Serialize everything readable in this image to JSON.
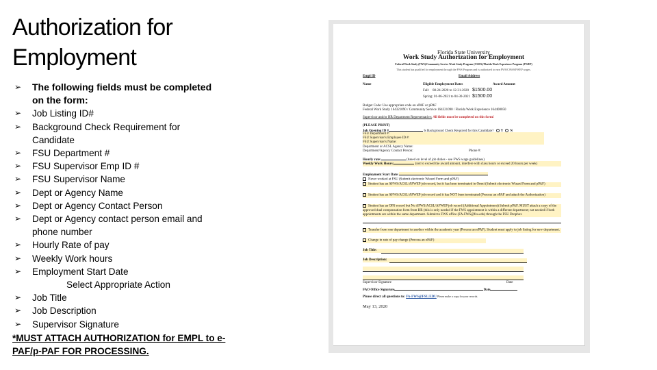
{
  "slide": {
    "title_line1": "Authorization for",
    "title_line2": "Employment",
    "lead_bullet_line1": "The following fields must be completed",
    "lead_bullet_line2": "on the form:",
    "bullet_glyph": "➢",
    "bullets_group1": [
      "Job Listing ID#",
      "Background Check Requirement for",
      "Candidate",
      "FSU Department #",
      "FSU Supervisor Emp ID #",
      "FSU Supervisor Name",
      "Dept or Agency Name",
      "Dept or Agency Contact Person",
      "Dept or Agency contact person email and",
      "phone number",
      "Hourly Rate of pay",
      "Weekly Work hours",
      "Employment Start Date"
    ],
    "centered_note": "Select Appropriate Action",
    "bullets_group2": [
      "Job Title",
      "Job Description",
      "Supervisor Signature"
    ],
    "must_attach_line1": "*MUST ATTACH AUTHORIZATION for EMPL to e-",
    "must_attach_line2": "PAF/p-PAF FOR PROCESSING."
  },
  "form_image": {
    "university": "Florida State University",
    "form_title": "Work Study Authorization for Employment",
    "programs": "Federal Work Study (FWS)/Community Service Work Study Program (CSWS)/Florida Work Experience Program (FWEP)",
    "eligibility_note": "This student has qualified for employment through the FWS Program and is authorized to earn FWS/CSWS/FWEP wages.",
    "emplid_label": "Empl ID",
    "email_label": "Email Address",
    "name_label": "Name",
    "dates_label": "Eligible Employment Dates",
    "award_label": "Award Amount",
    "term1": "Fall:",
    "term1_dates": "08-24-2020 to 12-31-2020",
    "term1_amount": "$1500.00",
    "term2": "Spring:",
    "term2_dates": "01-06-2021 to 04-30-2021",
    "term2_amount": "$1500.00",
    "budget_line1": "Budget Code: Use appropriate code on ePAF or pPAF",
    "budget_line2": "Federal Work Study 164321090 / Community Service 164321090 / Florida Work Experience 164400050",
    "supervisor_heading": "Supervisor and/or HR Department Representative:",
    "required_note": "All fields must be completed on this form!",
    "please_print": "(PLEASE PRINT)",
    "job_opening_label": "Job Opening ID #",
    "bg_check_label": "Is Background Check Required for this Candidate?",
    "yes_label": "Y",
    "no_label": "N",
    "dept_label": "FSU Department #:",
    "sup_emplid_label": "FSU Supervisor's Employee ID #:",
    "sup_name_label": "FSU Supervisor's Name:",
    "agency_label": "Department or ACSL Agency Name:",
    "contact_label": "Department/Agency Contact Person:",
    "phone_label": "Phone #:",
    "hourly_label": "Hourly rate:",
    "hourly_note": "(based on level of job duties - see FWS wage guidelines)",
    "weekly_label": "Weekly Work Hours:",
    "weekly_note": "(not to exceed the award amount, interfere with class hours or exceed 20 hours per week)",
    "start_label": "Employment Start Date:",
    "options": [
      "Never worked at FSU (Submit electronic Wizard Form and pPAF)",
      "Student has an AFWS/ACSL/AFWEP job record, but it has been terminated in Omni (Submit electronic Wizard Form and pPAF)",
      "Student has an AFWS/ACSL/AFWEP job record and it has NOT been terminated (Process an ePAF and attach the Authorization)",
      "Student has an OPS record but No AFWS/ACSL/AFWEP job record (Additional Appointment) Submit pPAF. MUST attach a copy of the approved dual compensation form from HR (this is only needed if the FWS appointment is within a different department; not needed if both appointments are within the same department. Submit to FWS office (FA-FWS@fsu.edu) through the FSU Dropbox",
      "Transfer from one department to another within the academic year (Process an ePAF). Student must apply to job listing for new department.",
      "Change in rate of pay change (Process an ePAF)"
    ],
    "job_title_label": "Job Title:",
    "job_desc_label": "Job Description:",
    "sup_sig_label": "Supervisor Signature",
    "date_label": "Date",
    "faid_sig_label": "FAO Office Signature",
    "date_label2": "Date",
    "questions_text": "Please direct all questions to:",
    "questions_email": "FA-FWS@FSU.EDU",
    "copy_note": "Please make a copy for your records.",
    "form_date": "May 13, 2020"
  }
}
